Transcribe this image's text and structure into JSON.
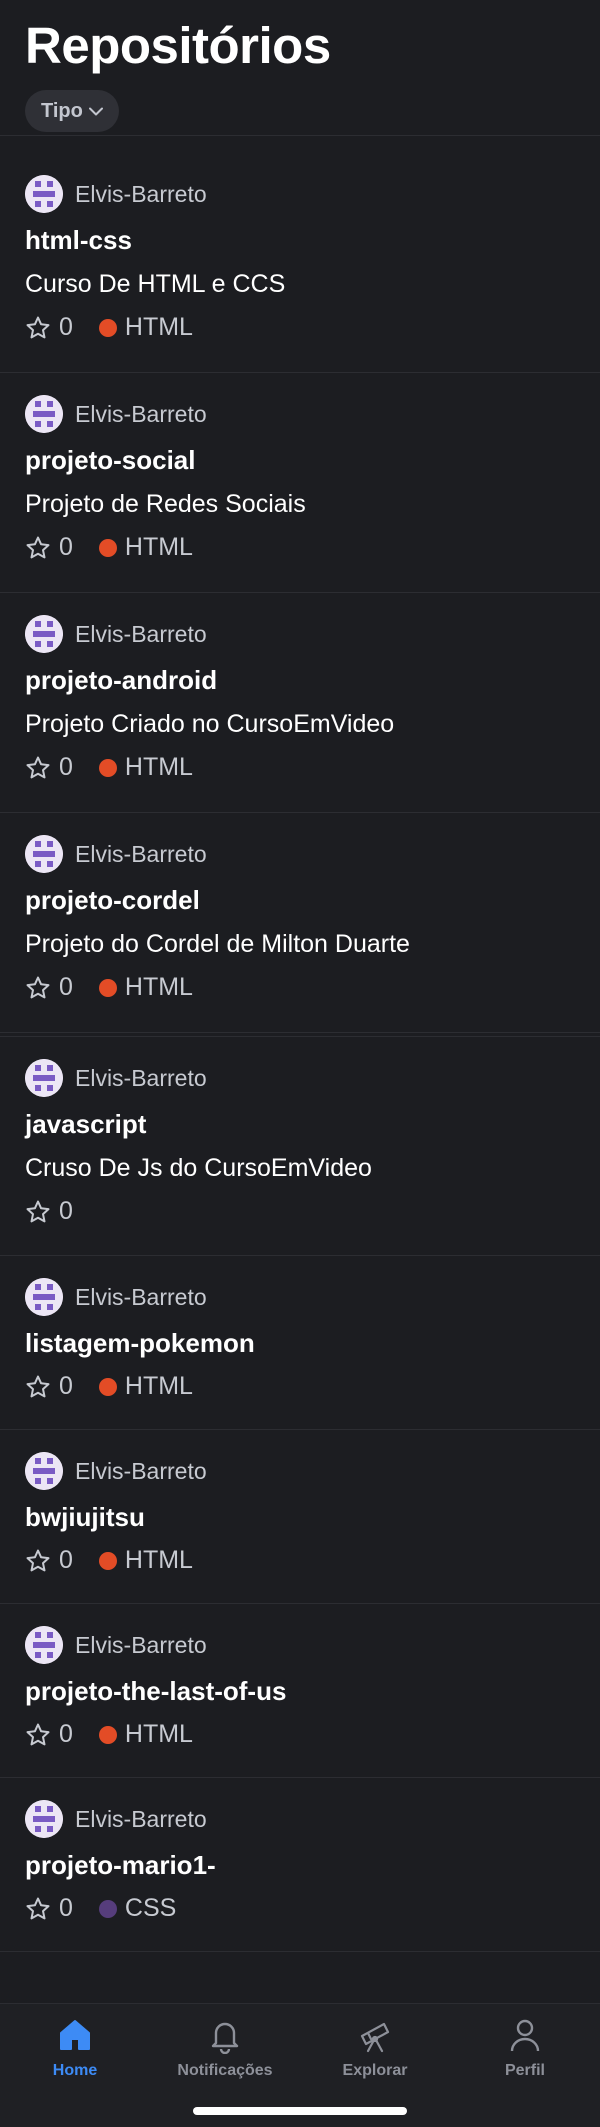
{
  "header": {
    "title": "Repositórios",
    "filter_label": "Tipo"
  },
  "colors": {
    "background": "#1c1d21",
    "html_lang": "#e34c26",
    "css_lang": "#563d7c",
    "active_tab": "#3d8bf5",
    "inactive_tab": "#8d9099"
  },
  "repos": [
    {
      "owner": "Elvis-Barreto",
      "name": "html-css",
      "description": "Curso De HTML e CCS",
      "stars": "0",
      "language": "HTML",
      "language_color": "#e34c26"
    },
    {
      "owner": "Elvis-Barreto",
      "name": "projeto-social",
      "description": "Projeto de Redes Sociais",
      "stars": "0",
      "language": "HTML",
      "language_color": "#e34c26"
    },
    {
      "owner": "Elvis-Barreto",
      "name": "projeto-android",
      "description": "Projeto Criado no CursoEmVideo",
      "stars": "0",
      "language": "HTML",
      "language_color": "#e34c26"
    },
    {
      "owner": "Elvis-Barreto",
      "name": "projeto-cordel",
      "description": "Projeto do Cordel de Milton Duarte",
      "stars": "0",
      "language": "HTML",
      "language_color": "#e34c26"
    },
    {
      "owner": "Elvis-Barreto",
      "name": "javascript",
      "description": "Cruso De Js do CursoEmVideo",
      "stars": "0",
      "language": "",
      "language_color": ""
    },
    {
      "owner": "Elvis-Barreto",
      "name": "listagem-pokemon",
      "description": "",
      "stars": "0",
      "language": "HTML",
      "language_color": "#e34c26"
    },
    {
      "owner": "Elvis-Barreto",
      "name": "bwjiujitsu",
      "description": "",
      "stars": "0",
      "language": "HTML",
      "language_color": "#e34c26"
    },
    {
      "owner": "Elvis-Barreto",
      "name": "projeto-the-last-of-us",
      "description": "",
      "stars": "0",
      "language": "HTML",
      "language_color": "#e34c26"
    },
    {
      "owner": "Elvis-Barreto",
      "name": "projeto-mario1-",
      "description": "",
      "stars": "0",
      "language": "CSS",
      "language_color": "#563d7c"
    }
  ],
  "tabs": [
    {
      "label": "Home",
      "icon": "home-icon",
      "active": true
    },
    {
      "label": "Notificações",
      "icon": "bell-icon",
      "active": false
    },
    {
      "label": "Explorar",
      "icon": "telescope-icon",
      "active": false
    },
    {
      "label": "Perfil",
      "icon": "person-icon",
      "active": false
    }
  ]
}
